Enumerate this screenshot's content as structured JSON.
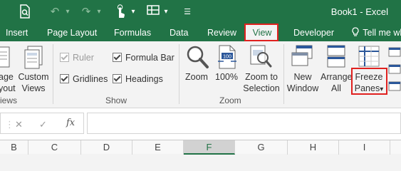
{
  "title_bar": {
    "app_title": "Book1 - Excel",
    "icons": [
      "file-preview-icon",
      "undo-icon",
      "redo-icon",
      "touch-mode-icon",
      "layout-icon",
      "customize-qat-icon"
    ]
  },
  "tabs": [
    {
      "label": "Insert",
      "active": false
    },
    {
      "label": "Page Layout",
      "active": false
    },
    {
      "label": "Formulas",
      "active": false
    },
    {
      "label": "Data",
      "active": false
    },
    {
      "label": "Review",
      "active": false
    },
    {
      "label": "View",
      "active": true
    },
    {
      "label": "Developer",
      "active": false
    }
  ],
  "tell_me": "Tell me wh",
  "ribbon": {
    "workbook_views": {
      "page_layout_l1": "age",
      "page_layout_l2": "yout",
      "custom_views_l1": "Custom",
      "custom_views_l2": "Views",
      "group_label": "iews"
    },
    "show": {
      "ruler": "Ruler",
      "ruler_checked": true,
      "ruler_enabled": false,
      "gridlines": "Gridlines",
      "gridlines_checked": true,
      "formula_bar": "Formula Bar",
      "formula_bar_checked": true,
      "headings": "Headings",
      "headings_checked": true,
      "group_label": "Show"
    },
    "zoom": {
      "zoom": "Zoom",
      "zoom_100": "100%",
      "zoom_to_selection_l1": "Zoom to",
      "zoom_to_selection_l2": "Selection",
      "group_label": "Zoom",
      "icon_100_text": "100"
    },
    "window": {
      "new_window_l1": "New",
      "new_window_l2": "Window",
      "arrange_all_l1": "Arrange",
      "arrange_all_l2": "All",
      "freeze_panes_l1": "Freeze",
      "freeze_panes_l2": "Panes",
      "freeze_panes_arrow": "▾"
    }
  },
  "formula_bar": {
    "cancel": "✕",
    "enter": "✓",
    "fx": "fx",
    "value": ""
  },
  "columns": [
    "B",
    "C",
    "D",
    "E",
    "F",
    "G",
    "H",
    "I"
  ],
  "selected_column": "F",
  "colors": {
    "excel_green": "#217346",
    "highlight_red": "#e0211f"
  }
}
